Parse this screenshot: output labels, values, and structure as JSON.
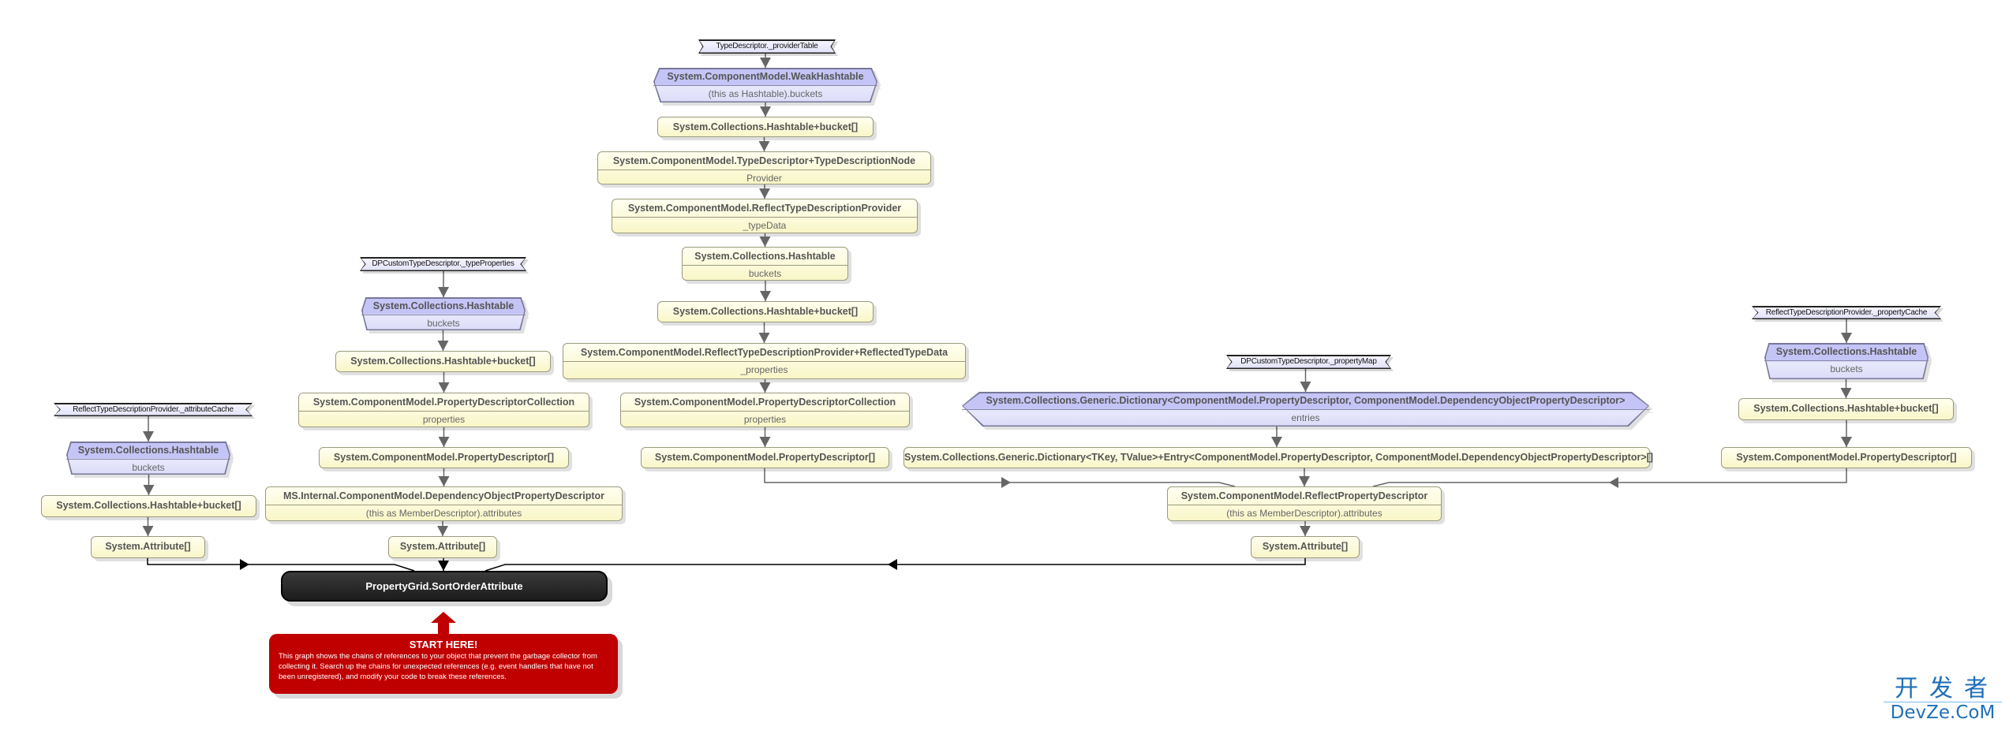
{
  "nodes": [
    {
      "kind": "l",
      "title": "TypeDescriptor._providerTable"
    },
    {
      "kind": "b",
      "title": "System.ComponentModel.WeakHashtable",
      "subtitle": "(this as Hashtable).buckets"
    },
    {
      "kind": "y",
      "title": "System.Collections.Hashtable+bucket[]"
    },
    {
      "kind": "y",
      "title": "System.ComponentModel.TypeDescriptor+TypeDescriptionNode",
      "subtitle": "Provider"
    },
    {
      "kind": "y",
      "title": "System.ComponentModel.ReflectTypeDescriptionProvider",
      "subtitle": "_typeData"
    },
    {
      "kind": "y",
      "title": "System.Collections.Hashtable",
      "subtitle": "buckets"
    },
    {
      "kind": "y",
      "title": "System.Collections.Hashtable+bucket[]"
    },
    {
      "kind": "y",
      "title": "System.ComponentModel.ReflectTypeDescriptionProvider+ReflectedTypeData",
      "subtitle": "_properties"
    },
    {
      "kind": "y",
      "title": "System.ComponentModel.PropertyDescriptorCollection",
      "subtitle": "properties"
    },
    {
      "kind": "y",
      "title": "System.ComponentModel.PropertyDescriptor[]"
    },
    {
      "kind": "l",
      "title": "DPCustomTypeDescriptor._typeProperties"
    },
    {
      "kind": "b",
      "title": "System.Collections.Hashtable",
      "subtitle": "buckets"
    },
    {
      "kind": "y",
      "title": "System.Collections.Hashtable+bucket[]"
    },
    {
      "kind": "y",
      "title": "System.ComponentModel.PropertyDescriptorCollection",
      "subtitle": "properties"
    },
    {
      "kind": "y",
      "title": "System.ComponentModel.PropertyDescriptor[]"
    },
    {
      "kind": "y",
      "title": "MS.Internal.ComponentModel.DependencyObjectPropertyDescriptor",
      "subtitle": "(this as MemberDescriptor).attributes"
    },
    {
      "kind": "y",
      "title": "System.Attribute[]"
    },
    {
      "kind": "l",
      "title": "ReflectTypeDescriptionProvider._attributeCache"
    },
    {
      "kind": "b",
      "title": "System.Collections.Hashtable",
      "subtitle": "buckets"
    },
    {
      "kind": "y",
      "title": "System.Collections.Hashtable+bucket[]"
    },
    {
      "kind": "y",
      "title": "System.Attribute[]"
    },
    {
      "kind": "l",
      "title": "DPCustomTypeDescriptor._propertyMap"
    },
    {
      "kind": "b",
      "title": "System.Collections.Generic.Dictionary<ComponentModel.PropertyDescriptor,  ComponentModel.DependencyObjectPropertyDescriptor>",
      "subtitle": "entries"
    },
    {
      "kind": "y",
      "title": "System.Collections.Generic.Dictionary<TKey,  TValue>+Entry<ComponentModel.PropertyDescriptor,  ComponentModel.DependencyObjectPropertyDescriptor>[]"
    },
    {
      "kind": "y",
      "title": "System.ComponentModel.ReflectPropertyDescriptor",
      "subtitle": "(this as MemberDescriptor).attributes"
    },
    {
      "kind": "y",
      "title": "System.Attribute[]"
    },
    {
      "kind": "l",
      "title": "ReflectTypeDescriptionProvider._propertyCache"
    },
    {
      "kind": "b",
      "title": "System.Collections.Hashtable",
      "subtitle": "buckets"
    },
    {
      "kind": "y",
      "title": "System.Collections.Hashtable+bucket[]"
    },
    {
      "kind": "y",
      "title": "System.ComponentModel.PropertyDescriptor[]"
    }
  ],
  "target": {
    "title": "PropertyGrid.SortOrderAttribute"
  },
  "start_here": {
    "title": "START HERE!",
    "text": "This graph shows the chains of references to your object that prevent the garbage collector from collecting it. Search up the chains for unexpected references (e.g. event handlers that have not been unregistered), and modify your code to break these references."
  },
  "watermark": {
    "cn": "开发者",
    "en": "DevZe.CoM"
  },
  "colors": {
    "object_node": "#fffbd0",
    "root_node": "#c4c4f6",
    "target_node": "#222222",
    "start_here": "#c00000",
    "edge": "#666666"
  }
}
